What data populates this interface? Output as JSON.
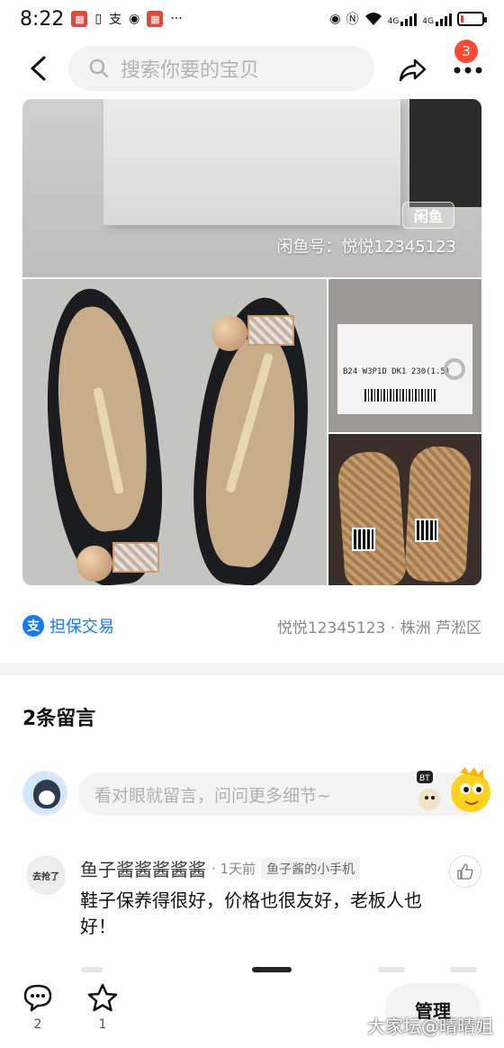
{
  "status_bar": {
    "time": "8:22",
    "network": "4G",
    "battery_level": 0.12,
    "icons": [
      "app-badge-icon",
      "sim-icon",
      "alipay-icon",
      "wechat-icon",
      "app-badge-icon",
      "more-dots-icon",
      "eye-icon",
      "nfc-icon",
      "wifi-icon",
      "signal-icon",
      "battery-icon"
    ]
  },
  "header": {
    "search_placeholder": "搜索你要的宝贝",
    "notification_count": "3"
  },
  "gallery": {
    "watermark_logo": "闲鱼",
    "watermark_text": "闲鱼号：悦悦12345123",
    "box_code": "B24  W3P1D  DK1  230(1.5)"
  },
  "info": {
    "guarantee_label": "担保交易",
    "seller_location": "悦悦12345123 · 株洲 芦淞区"
  },
  "comments": {
    "title": "2条留言",
    "input_placeholder": "看对眼就留言，问问更多细节~",
    "items": [
      {
        "avatar_text": "去抢了",
        "name": "鱼子酱酱酱酱酱",
        "time": "· 1天前",
        "device": "鱼子酱的小手机",
        "text": "鞋子保养得很好，价格也很友好，老板人也好！"
      }
    ]
  },
  "bottom_bar": {
    "comment_count": "2",
    "favorite_count": "1",
    "manage_label": "管理",
    "watermark": "大家坛@晴晴姐"
  },
  "colors": {
    "accent_blue": "#1677ff",
    "badge_red": "#ff4b33"
  }
}
